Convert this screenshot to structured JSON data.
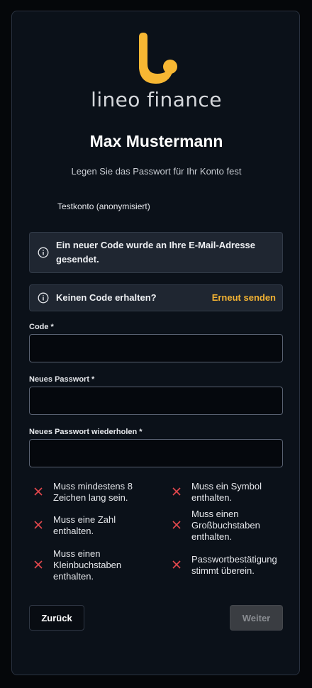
{
  "brand": {
    "name": "lineo finance",
    "logo_icon": "lineo-logo-icon",
    "accent": "#f7b733"
  },
  "header": {
    "user_name": "Max Mustermann",
    "subtitle": "Legen Sie das Passwort für Ihr Konto fest",
    "account_label": "Testkonto (anonymisiert)"
  },
  "notices": {
    "code_sent": "Ein neuer Code wurde an Ihre E-Mail-Adresse gesendet.",
    "no_code": "Keinen Code erhalten?",
    "resend": "Erneut senden"
  },
  "form": {
    "code_label": "Code *",
    "code_value": "",
    "new_password_label": "Neues Passwort *",
    "new_password_value": "",
    "repeat_password_label": "Neues Passwort wiederholen *",
    "repeat_password_value": ""
  },
  "rules": [
    {
      "text": "Muss mindestens 8 Zeichen lang sein.",
      "met": false
    },
    {
      "text": "Muss ein Symbol enthalten.",
      "met": false
    },
    {
      "text": "Muss eine Zahl enthalten.",
      "met": false
    },
    {
      "text": "Muss einen Großbuchstaben enthalten.",
      "met": false
    },
    {
      "text": "Muss einen Kleinbuchstaben enthalten.",
      "met": false
    },
    {
      "text": "Passwortbestätigung stimmt überein.",
      "met": false
    }
  ],
  "rule_fail_color": "#e5484d",
  "buttons": {
    "back": "Zurück",
    "next": "Weiter"
  }
}
